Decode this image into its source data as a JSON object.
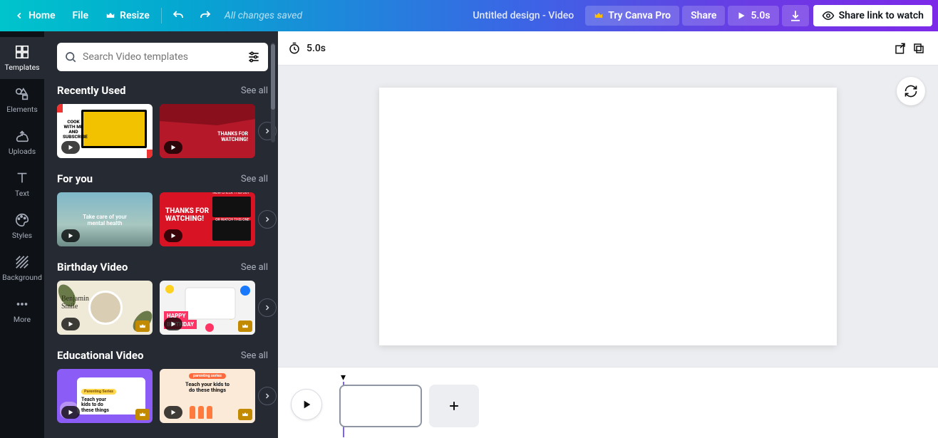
{
  "topbar": {
    "home": "Home",
    "file": "File",
    "resize": "Resize",
    "status": "All changes saved",
    "title": "Untitled design - Video",
    "try_pro": "Try Canva Pro",
    "share": "Share",
    "duration": "5.0s",
    "share_link": "Share link to watch"
  },
  "rail": {
    "templates": "Templates",
    "elements": "Elements",
    "uploads": "Uploads",
    "text": "Text",
    "styles": "Styles",
    "background": "Background",
    "more": "More"
  },
  "search": {
    "placeholder": "Search Video templates"
  },
  "sections": {
    "recent": {
      "title": "Recently Used",
      "see_all": "See all",
      "t1_line1": "COOK",
      "t1_line2": "WITH ME",
      "t1_line3": "AND",
      "t1_line4": "SUBSCRIBE",
      "t2_txt": "THANKS FOR\nWATCHING!"
    },
    "foryou": {
      "title": "For you",
      "see_all": "See all",
      "t3_txt": "Take care of your\nmental health",
      "t4_big": "THANKS FOR\nWATCHING!",
      "t4_lab1": "NOW CHECK THIS OUT",
      "t4_lab2": "OR WATCH THIS ONE"
    },
    "birthday": {
      "title": "Birthday Video",
      "see_all": "See all",
      "t5_name": "Benjamin\nSmile",
      "t6_bar": "HAPPY",
      "t6_bar2": "BIRTHDAY"
    },
    "edu": {
      "title": "Educational Video",
      "see_all": "See all",
      "t7_pill": "Parenting Series",
      "t7_txt": "Teach your\nkids to do\nthese things",
      "t8_pill": "parenting series",
      "t8_txt": "Teach your kids to\ndo these things"
    }
  },
  "stage": {
    "duration": "5.0s"
  }
}
